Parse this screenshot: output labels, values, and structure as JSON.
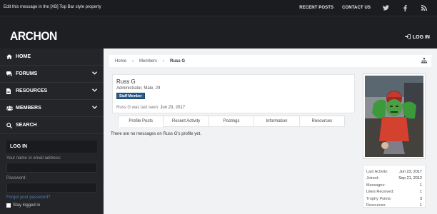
{
  "topbar": {
    "message": "Edit this message in the [XB] Top Bar style property",
    "links": [
      "RECENT POSTS",
      "CONTACT US"
    ],
    "social_icons": [
      "twitter-icon",
      "facebook-icon",
      "rss-icon"
    ]
  },
  "header": {
    "logo": "ARCHON",
    "login_label": "LOG IN"
  },
  "sidebar": {
    "nav": [
      {
        "label": "HOME",
        "icon": "home-icon"
      },
      {
        "label": "FORUMS",
        "icon": "comments-icon"
      },
      {
        "label": "RESOURCES",
        "icon": "file-icon"
      },
      {
        "label": "MEMBERS",
        "icon": "users-icon"
      },
      {
        "label": "SEARCH",
        "icon": "search-icon"
      }
    ],
    "login": {
      "title": "LOG IN",
      "username_label": "Your name or email address:",
      "password_label": "Password:",
      "forgot_label": "Forgot your password?",
      "stay_label": "Stay logged in"
    }
  },
  "breadcrumb": {
    "items": [
      "Home",
      "Members",
      "Russ G"
    ]
  },
  "profile": {
    "name": "Russ G",
    "info": "Administrator, Male, 29",
    "badge": "Staff Member",
    "last_seen_label": "Russ G was last seen:",
    "last_seen_value": "Jun 23, 2017"
  },
  "tabs": [
    "Profile Posts",
    "Recent Activity",
    "Postings",
    "Information",
    "Resources"
  ],
  "no_messages": "There are no messages on Russ G's profile yet.",
  "stats": [
    {
      "label": "Last Activity:",
      "value": "Jun 23, 2017"
    },
    {
      "label": "Joined:",
      "value": "Sep 21, 2012"
    },
    {
      "label": "Messages:",
      "value": "1"
    },
    {
      "label": "Likes Received:",
      "value": "1"
    },
    {
      "label": "Trophy Points:",
      "value": "3"
    },
    {
      "label": "Resources:",
      "value": "1"
    }
  ],
  "colors": {
    "accent": "#2a5d8f",
    "link": "#4e7fb8",
    "dark_bg": "#1d1f22"
  }
}
